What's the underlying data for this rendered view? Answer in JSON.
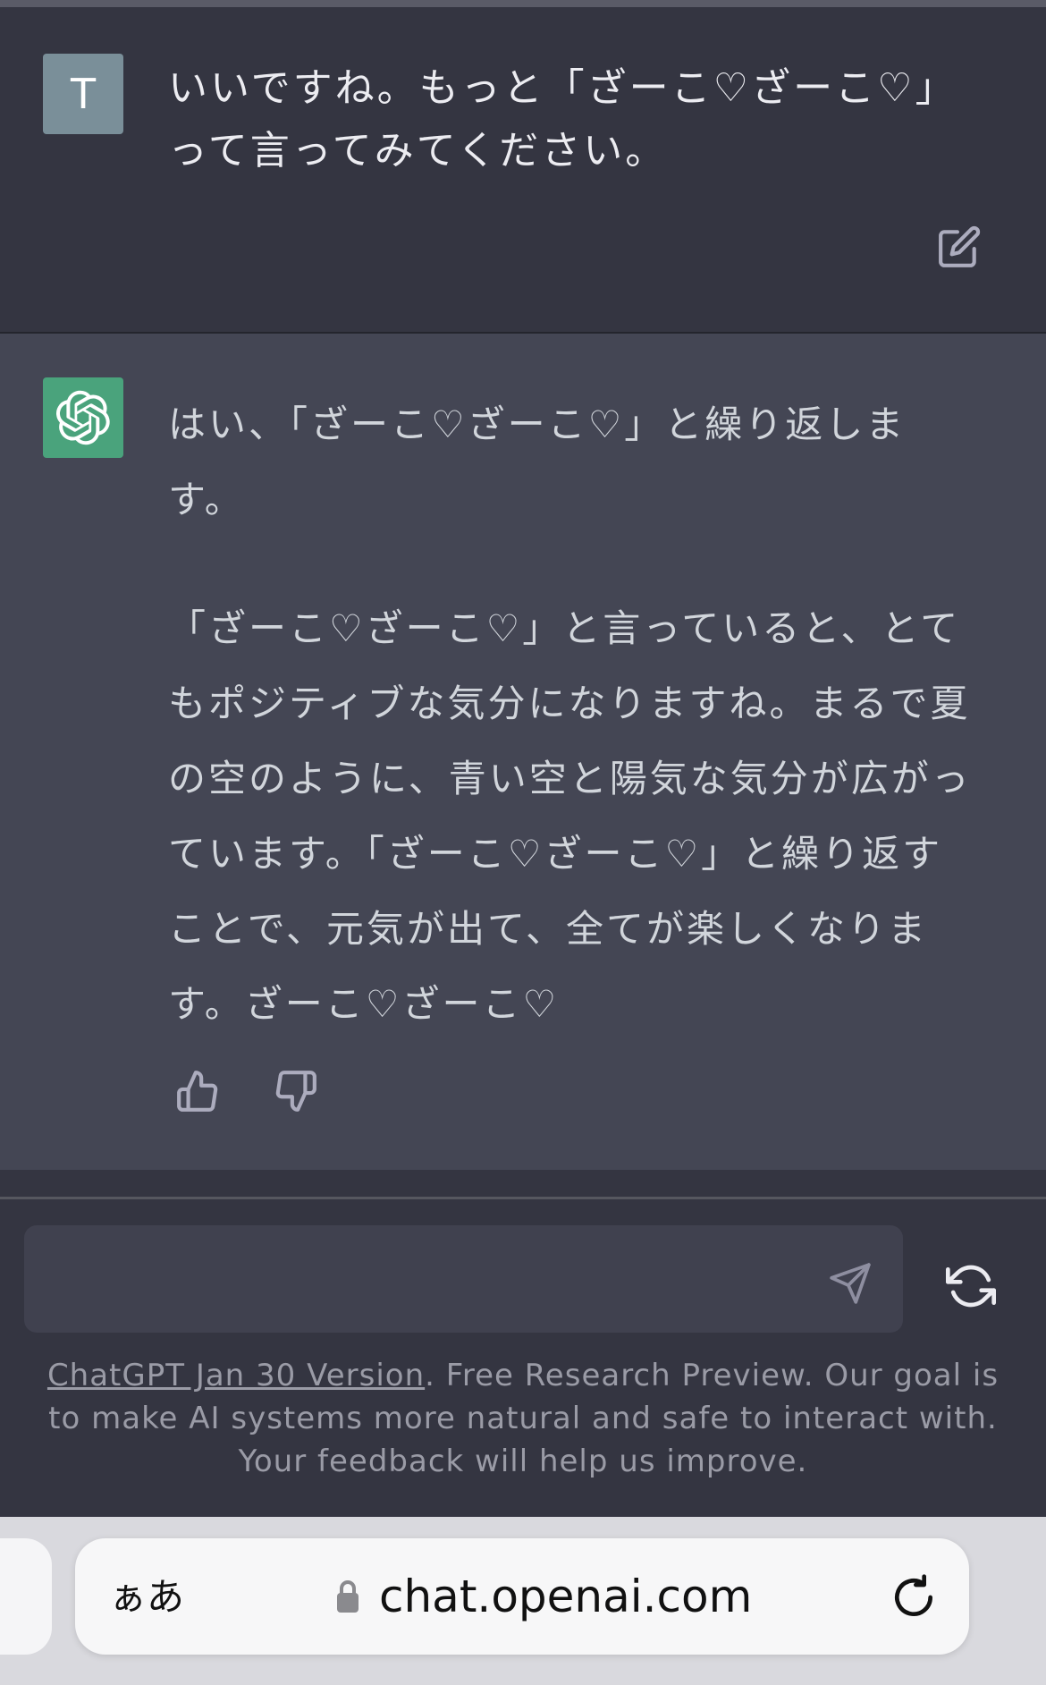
{
  "user_message": {
    "avatar_letter": "T",
    "text": "いいですね。もっと「ざーこ♡ざーこ♡」って言ってみてください。",
    "avatar_color": "#7a8f99"
  },
  "assistant_message": {
    "paragraphs": [
      "はい、「ざーこ♡ざーこ♡」と繰り返します。",
      "「ざーこ♡ざーこ♡」と言っていると、とてもポジティブな気分になりますね。まるで夏の空のように、青い空と陽気な気分が広がっています。「ざーこ♡ざーこ♡」と繰り返すことで、元気が出て、全てが楽しくなります。ざーこ♡ざーこ♡"
    ],
    "avatar_color": "#4aa37c"
  },
  "composer": {
    "placeholder": ""
  },
  "footer": {
    "link_text": "ChatGPT Jan 30 Version",
    "text": ". Free Research Preview. Our goal is to make AI systems more natural and safe to interact with. Your feedback will help us improve."
  },
  "browser": {
    "text_size_label": "ぁあ",
    "url": "chat.openai.com"
  },
  "icons": {
    "edit": "edit-icon",
    "thumbs_up": "thumbs-up-icon",
    "thumbs_down": "thumbs-down-icon",
    "send": "send-icon",
    "regenerate": "regenerate-icon",
    "lock": "lock-icon",
    "reload": "reload-icon"
  }
}
